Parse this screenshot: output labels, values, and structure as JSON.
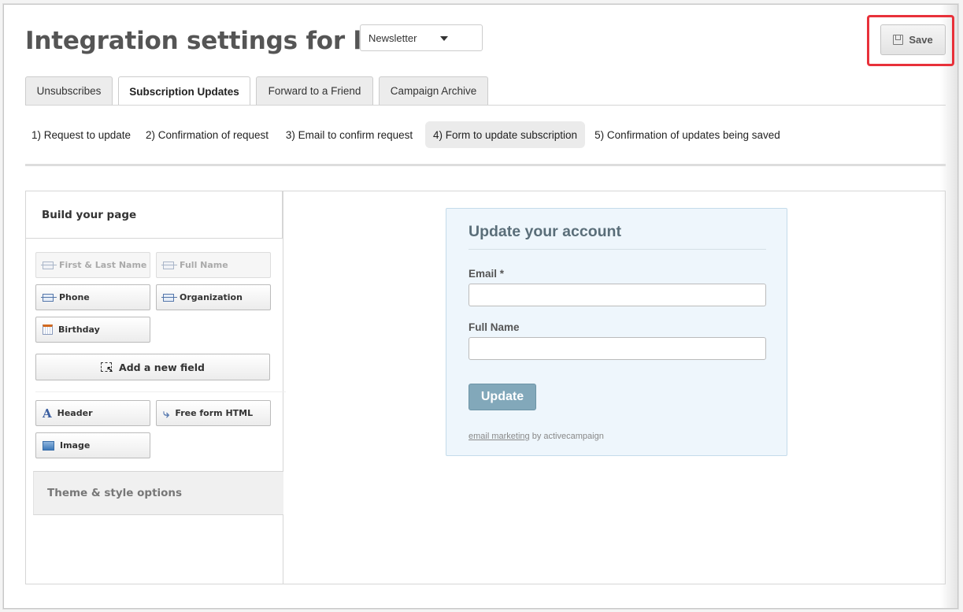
{
  "header": {
    "title": "Integration settings for list",
    "list_select": {
      "value": "Newsletter"
    },
    "save_label": "Save"
  },
  "tabs": [
    {
      "label": "Unsubscribes",
      "active": false
    },
    {
      "label": "Subscription Updates",
      "active": true
    },
    {
      "label": "Forward to a Friend",
      "active": false
    },
    {
      "label": "Campaign Archive",
      "active": false
    }
  ],
  "steps": [
    {
      "label": "1) Request to update",
      "active": false
    },
    {
      "label": "2) Confirmation of request",
      "active": false
    },
    {
      "label": "3) Email to confirm request",
      "active": false
    },
    {
      "label": "4) Form to update subscription",
      "active": true
    },
    {
      "label": "5) Confirmation of updates being saved",
      "active": false
    }
  ],
  "builder": {
    "heading": "Build your page",
    "fields": [
      {
        "label": "First & Last Name",
        "icon": "field-icon",
        "disabled": true
      },
      {
        "label": "Full Name",
        "icon": "field-icon",
        "disabled": true
      },
      {
        "label": "Phone",
        "icon": "field-icon",
        "disabled": false
      },
      {
        "label": "Organization",
        "icon": "field-icon",
        "disabled": false
      },
      {
        "label": "Birthday",
        "icon": "calendar-icon",
        "disabled": false
      }
    ],
    "add_field_label": "Add a new field",
    "elements": [
      {
        "label": "Header",
        "icon": "header-icon"
      },
      {
        "label": "Free form HTML",
        "icon": "html-icon"
      },
      {
        "label": "Image",
        "icon": "image-icon"
      }
    ],
    "theme_label": "Theme & style options"
  },
  "form": {
    "title": "Update your account",
    "email_label": "Email *",
    "email_value": "",
    "fullname_label": "Full Name",
    "fullname_value": "",
    "submit_label": "Update",
    "footer_link": "email marketing",
    "footer_text": "by activecampaign",
    "colors": {
      "background": "#eef6fc",
      "button": "#82a8ba"
    }
  },
  "colors": {
    "highlight": "#e8313a"
  }
}
